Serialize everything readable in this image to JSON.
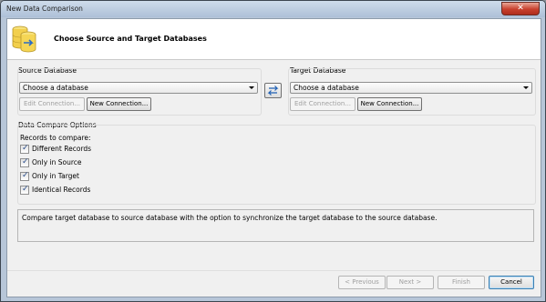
{
  "window": {
    "title": "New Data Comparison",
    "close_label": "✕"
  },
  "header": {
    "title": "Choose Source and Target Databases",
    "icon": "database-compare-icon"
  },
  "source": {
    "group_label": "Source Database",
    "select_value": "Choose a database",
    "edit_label": "Edit Connection...",
    "new_label": "New Connection..."
  },
  "target": {
    "group_label": "Target Database",
    "select_value": "Choose a database",
    "edit_label": "Edit Connection...",
    "new_label": "New Connection..."
  },
  "swap": {
    "icon": "swap-arrows-icon"
  },
  "options": {
    "group_label": "Data Compare Options",
    "records_label": "Records to compare:",
    "items": [
      {
        "label": "Different Records",
        "checked": true
      },
      {
        "label": "Only in Source",
        "checked": true
      },
      {
        "label": "Only in Target",
        "checked": true
      },
      {
        "label": "Identical Records",
        "checked": true
      }
    ]
  },
  "description": "Compare target database to source database with the option to synchronize the target database to the source database.",
  "footer": {
    "previous_label": "< Previous",
    "next_label": "Next >",
    "finish_label": "Finish",
    "cancel_label": "Cancel"
  }
}
